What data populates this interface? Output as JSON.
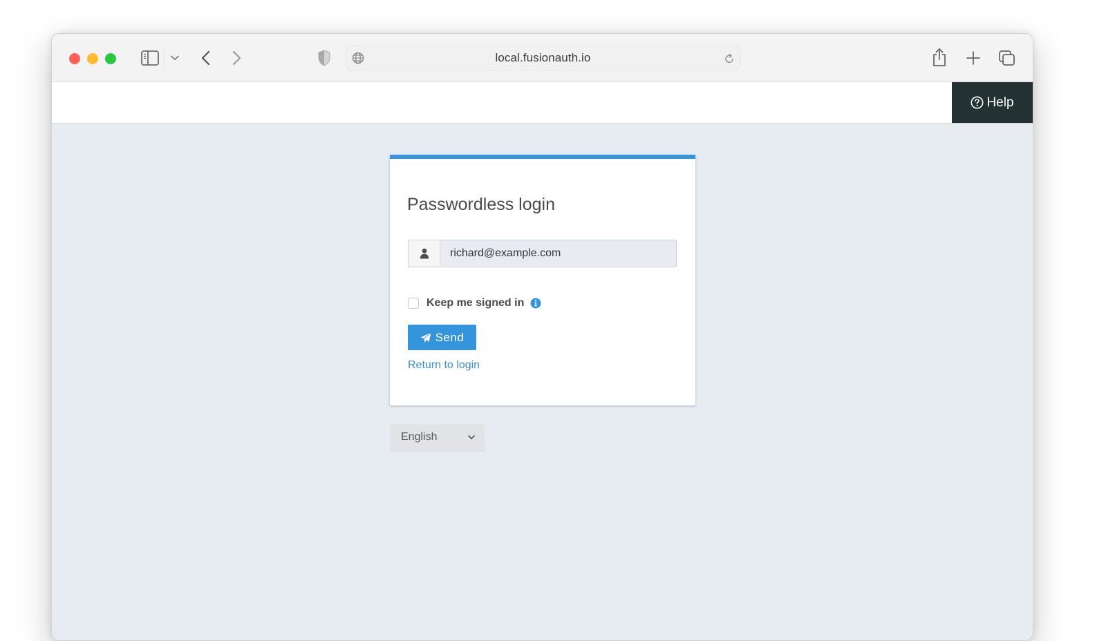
{
  "browser": {
    "url": "local.fusionauth.io",
    "icons": {
      "close": "traffic-light-close",
      "minimize": "traffic-light-minimize",
      "maximize": "traffic-light-maximize",
      "sidebar": "sidebar-icon",
      "sidebar_menu": "chevron-down-icon",
      "back": "chevron-left-icon",
      "forward": "chevron-right-icon",
      "privacy": "shield-icon",
      "site": "globe-icon",
      "reload": "reload-icon",
      "share": "share-icon",
      "new_tab": "plus-icon",
      "tabs": "tabs-overview-icon"
    }
  },
  "header": {
    "help_label": "Help",
    "help_icon": "question-circle-icon"
  },
  "card": {
    "accent_color": "#3595dc",
    "title": "Passwordless login",
    "login_field": {
      "icon": "user-icon",
      "value": "richard@example.com",
      "placeholder": ""
    },
    "keep_signed_in": {
      "label": "Keep me signed in",
      "checked": false,
      "info_icon": "info-circle-icon"
    },
    "send_button": {
      "label": "Send",
      "icon": "paper-plane-icon"
    },
    "return_link": "Return to login"
  },
  "language": {
    "selected": "English"
  }
}
